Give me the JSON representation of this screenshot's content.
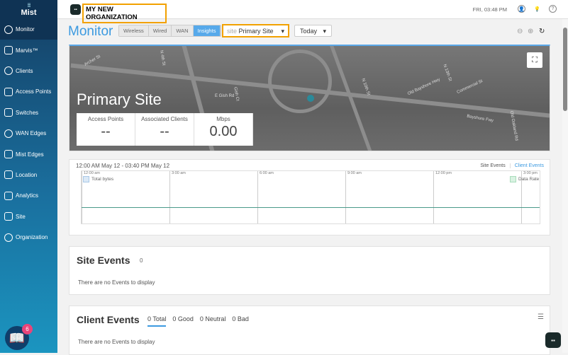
{
  "brand": "Mist",
  "org_name": "MY NEW ORGANIZATION",
  "datetime": "FRI, 03:48 PM",
  "sidebar": {
    "items": [
      {
        "label": "Monitor"
      },
      {
        "label": "Marvis™"
      },
      {
        "label": "Clients"
      },
      {
        "label": "Access Points"
      },
      {
        "label": "Switches"
      },
      {
        "label": "WAN Edges"
      },
      {
        "label": "Mist Edges"
      },
      {
        "label": "Location"
      },
      {
        "label": "Analytics"
      },
      {
        "label": "Site"
      },
      {
        "label": "Organization"
      }
    ],
    "help_badge": "6"
  },
  "header": {
    "title": "Monitor",
    "tabs": [
      "Wireless",
      "Wired",
      "WAN",
      "Insights"
    ],
    "active_tab": "Insights",
    "site_key": "site",
    "site_value": "Primary Site",
    "range": "Today"
  },
  "map": {
    "site_name": "Primary Site",
    "stats": [
      {
        "label": "Access Points",
        "value": "--"
      },
      {
        "label": "Associated Clients",
        "value": "--"
      },
      {
        "label": "Mbps",
        "value": "0.00"
      }
    ],
    "streets": [
      "Archer St",
      "N 4th St",
      "E Gish Rd",
      "Gish Ct",
      "N 10th St",
      "Old Bayshore Hwy",
      "Commercial St",
      "Bayshore Fwy",
      "N 13th St",
      "Old Oakland Rd"
    ]
  },
  "chart": {
    "range": "12:00 AM May 12 - 03:40 PM May 12",
    "tabs": [
      "Site Events",
      "Client Events"
    ],
    "ticks": [
      "12:00 am",
      "3:00 am",
      "6:00 am",
      "9:00 am",
      "12:00 pm",
      "3:00 pm"
    ],
    "legend_left": "Total bytes",
    "legend_right": "Data Rate"
  },
  "site_events": {
    "title": "Site Events",
    "count": "0",
    "empty": "There are no Events to display"
  },
  "client_events": {
    "title": "Client Events",
    "tabs": [
      "0 Total",
      "0 Good",
      "0 Neutral",
      "0 Bad"
    ],
    "empty": "There are no Events to display"
  },
  "colors": {
    "accent": "#3c9ae0",
    "highlight": "#f2a100"
  }
}
